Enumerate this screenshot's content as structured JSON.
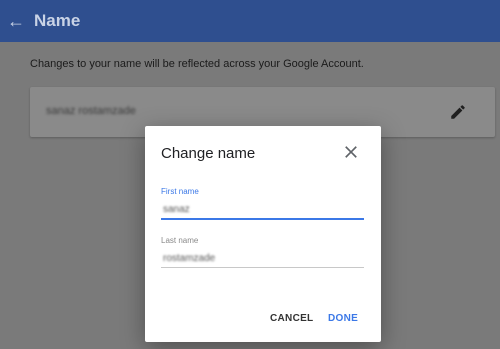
{
  "appbar": {
    "title": "Name",
    "back_icon": "arrow-left-icon"
  },
  "page": {
    "description": "Changes to your name will be reflected across your Google Account.",
    "current_name": "sanaz rostamzade",
    "edit_icon": "pencil-icon"
  },
  "dialog": {
    "title": "Change name",
    "close_icon": "close-icon",
    "first_name_label": "First name",
    "first_name_value": "sanaz",
    "last_name_label": "Last name",
    "last_name_value": "rostamzade",
    "cancel_label": "CANCEL",
    "done_label": "DONE"
  },
  "colors": {
    "accent": "#3b78e7",
    "appbar": "#2f4f8f"
  }
}
